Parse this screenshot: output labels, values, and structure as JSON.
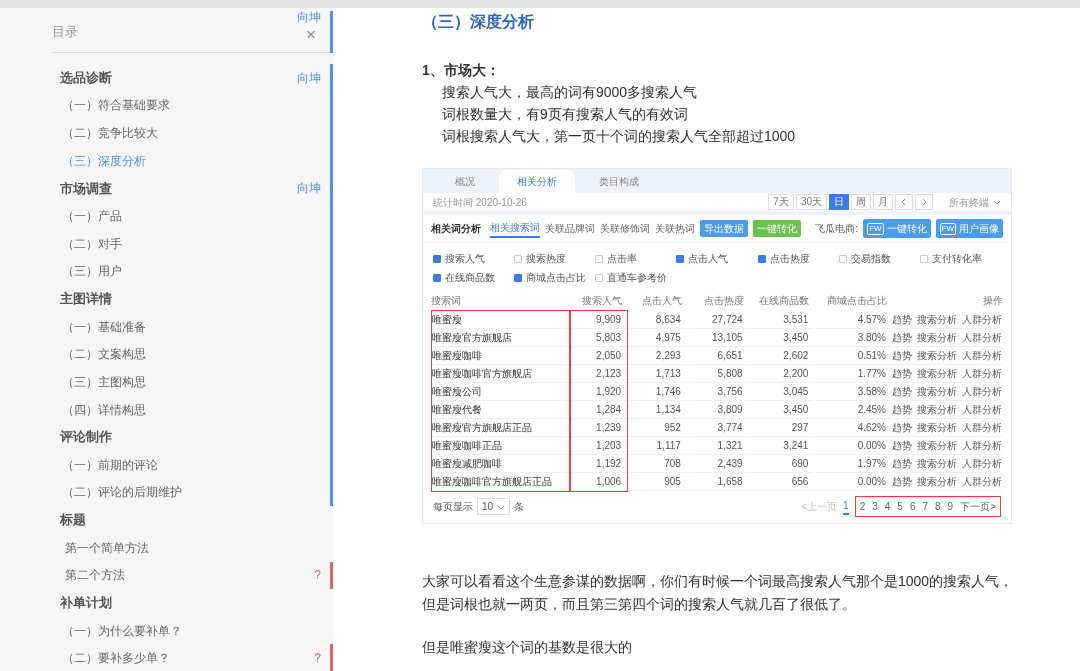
{
  "toc": {
    "title": "目录",
    "close": "×",
    "note": "向坤",
    "color": "#4e8ef7"
  },
  "toc_items": [
    {
      "kind": "heading",
      "label": "选品诊断",
      "selected": false,
      "note": "向坤",
      "color": "#4e8ef7"
    },
    {
      "kind": "sub",
      "label": "（一）符合基础要求",
      "selected": false,
      "color": "#4e8ef7"
    },
    {
      "kind": "sub",
      "label": "（二）竞争比较大",
      "selected": false,
      "color": "#4e8ef7"
    },
    {
      "kind": "sub",
      "label": "（三）深度分析",
      "selected": true,
      "color": "#4e8ef7"
    },
    {
      "kind": "heading",
      "label": "市场调查",
      "selected": false,
      "note": "向坤",
      "color": "#4e8ef7"
    },
    {
      "kind": "sub",
      "label": "（一）产品",
      "selected": false,
      "color": "#4e8ef7"
    },
    {
      "kind": "sub",
      "label": "（二）对手",
      "selected": false,
      "color": "#4e8ef7"
    },
    {
      "kind": "sub",
      "label": "（三）用户",
      "selected": false,
      "color": "#4e8ef7"
    },
    {
      "kind": "heading",
      "label": "主图详情",
      "selected": false,
      "color": "#4e8ef7"
    },
    {
      "kind": "sub",
      "label": "（一）基础准备",
      "selected": false,
      "color": "#4e8ef7"
    },
    {
      "kind": "sub",
      "label": "（二）文案构思",
      "selected": false,
      "color": "#4e8ef7"
    },
    {
      "kind": "sub",
      "label": "（三）主图构思",
      "selected": false,
      "color": "#4e8ef7"
    },
    {
      "kind": "sub",
      "label": "（四）详情构思",
      "selected": false,
      "color": "#4e8ef7"
    },
    {
      "kind": "heading",
      "label": "评论制作",
      "selected": false,
      "color": "#4e8ef7"
    },
    {
      "kind": "sub",
      "label": "（一）前期的评论",
      "selected": false,
      "color": "#4e8ef7"
    },
    {
      "kind": "sub",
      "label": "（二）评论的后期维护",
      "selected": false,
      "color": "#4e8ef7"
    },
    {
      "kind": "heading",
      "label": "标题",
      "selected": false
    },
    {
      "kind": "plain",
      "label": "第一个简单方法",
      "selected": false
    },
    {
      "kind": "plain",
      "label": "第二个方法",
      "selected": false,
      "note": "?",
      "color": "#e8616b"
    },
    {
      "kind": "heading",
      "label": "补单计划",
      "selected": false
    },
    {
      "kind": "sub",
      "label": "（一）为什么要补单？",
      "selected": false
    },
    {
      "kind": "sub",
      "label": "（二）要补多少单？",
      "selected": false,
      "note": "?",
      "color": "#e8616b"
    }
  ],
  "article": {
    "heading": "（三）深度分析",
    "point": "1、市场大：",
    "lines": [
      "搜索人气大，最高的词有9000多搜索人气",
      "词根数量大，有9页有搜索人气的有效词",
      "词根搜索人气大，第一页十个词的搜索人气全部超过1000"
    ],
    "paragraphs": [
      "大家可以看看这个生意参谋的数据啊，你们有时候一个词最高搜索人气那个是1000的搜索人气，但是词根也就一两页，而且第三第四个词的搜索人气就几百了很低了。",
      "但是唯蜜瘦这个词的基数是很大的"
    ]
  },
  "screenshot": {
    "tabs": [
      {
        "label": "概况",
        "selected": false
      },
      {
        "label": "相关分析",
        "selected": true
      },
      {
        "label": "类目构成",
        "selected": false
      }
    ],
    "date": "统计时间 2020-10-26",
    "ranges": [
      {
        "label": "7天",
        "selected": false
      },
      {
        "label": "30天",
        "selected": false
      },
      {
        "label": "日",
        "selected": true
      },
      {
        "label": "周",
        "selected": false
      },
      {
        "label": "月",
        "selected": false
      }
    ],
    "terminal": "所有终端",
    "title": "相关词分析",
    "subtabs": [
      {
        "label": "相关搜索词",
        "selected": true
      },
      {
        "label": "关联品牌词",
        "selected": false
      },
      {
        "label": "关联修饰词",
        "selected": false
      },
      {
        "label": "关联热词",
        "selected": false
      }
    ],
    "actions": [
      {
        "label": "导出数据",
        "kind": "primary"
      },
      {
        "label": "一键转化",
        "kind": "success"
      }
    ],
    "plugin_label": "飞瓜电商:",
    "plugin_buttons": [
      {
        "badge": "FW",
        "label": "一键转化"
      },
      {
        "badge": "FW",
        "label": "用户画像"
      }
    ],
    "metrics": [
      {
        "label": "搜索人气",
        "checked": true
      },
      {
        "label": "搜索热度",
        "checked": false
      },
      {
        "label": "点击率",
        "checked": false
      },
      {
        "label": "点击人气",
        "checked": true
      },
      {
        "label": "点击热度",
        "checked": true
      },
      {
        "label": "交易指数",
        "checked": false
      },
      {
        "label": "支付转化率",
        "checked": false
      },
      {
        "label": "在线商品数",
        "checked": true
      },
      {
        "label": "商城点击占比",
        "checked": true
      },
      {
        "label": "直通车参考价",
        "checked": false
      }
    ],
    "columns": [
      {
        "label": "搜索词",
        "highlighted": true
      },
      {
        "label": "搜索人气",
        "highlighted": true
      },
      {
        "label": "点击人气",
        "highlighted": false
      },
      {
        "label": "点击热度",
        "highlighted": false
      },
      {
        "label": "在线商品数",
        "highlighted": false
      },
      {
        "label": "商城点击占比",
        "highlighted": false
      },
      {
        "label": "操作",
        "highlighted": false
      }
    ],
    "rows": [
      {
        "cells": [
          "唯蜜瘦",
          "9,909",
          "8,634",
          "27,724",
          "3,531",
          "4.57%"
        ],
        "actions": [
          "趋势",
          "搜索分析",
          "人群分析"
        ]
      },
      {
        "cells": [
          "唯蜜瘦官方旗舰店",
          "5,803",
          "4,975",
          "13,105",
          "3,450",
          "3.80%"
        ],
        "actions": [
          "趋势",
          "搜索分析",
          "人群分析"
        ]
      },
      {
        "cells": [
          "唯蜜瘦咖啡",
          "2,050",
          "2,293",
          "6,651",
          "2,602",
          "0.51%"
        ],
        "actions": [
          "趋势",
          "搜索分析",
          "人群分析"
        ]
      },
      {
        "cells": [
          "唯蜜瘦咖啡官方旗舰店",
          "2,123",
          "1,713",
          "5,808",
          "2,200",
          "1.77%"
        ],
        "actions": [
          "趋势",
          "搜索分析",
          "人群分析"
        ]
      },
      {
        "cells": [
          "唯蜜瘦公司",
          "1,920",
          "1,746",
          "3,756",
          "3,045",
          "3.58%"
        ],
        "actions": [
          "趋势",
          "搜索分析",
          "人群分析"
        ]
      },
      {
        "cells": [
          "唯蜜瘦代餐",
          "1,284",
          "1,134",
          "3,809",
          "3,450",
          "2.45%"
        ],
        "actions": [
          "趋势",
          "搜索分析",
          "人群分析"
        ]
      },
      {
        "cells": [
          "唯蜜瘦官方旗舰店正品",
          "1,239",
          "952",
          "3,774",
          "297",
          "4.62%"
        ],
        "actions": [
          "趋势",
          "搜索分析",
          "人群分析"
        ]
      },
      {
        "cells": [
          "唯蜜瘦咖啡正品",
          "1,203",
          "1,117",
          "1,321",
          "3,241",
          "0.00%"
        ],
        "actions": [
          "趋势",
          "搜索分析",
          "人群分析"
        ]
      },
      {
        "cells": [
          "唯蜜瘦减肥咖啡",
          "1,192",
          "708",
          "2,439",
          "690",
          "1.97%"
        ],
        "actions": [
          "趋势",
          "搜索分析",
          "人群分析"
        ]
      },
      {
        "cells": [
          "唯蜜瘦咖啡官方旗舰店正品",
          "1,006",
          "905",
          "1,658",
          "656",
          "0.00%"
        ],
        "actions": [
          "趋势",
          "搜索分析",
          "人群分析"
        ]
      }
    ],
    "page_size": {
      "before": "每页显示",
      "value": "10",
      "after": "条"
    },
    "pagination": {
      "prev": "<上一页",
      "pages": [
        {
          "label": "1",
          "selected": true
        },
        {
          "label": "2",
          "selected": false
        },
        {
          "label": "3",
          "selected": false
        },
        {
          "label": "4",
          "selected": false
        },
        {
          "label": "5",
          "selected": false
        },
        {
          "label": "6",
          "selected": false
        },
        {
          "label": "7",
          "selected": false
        },
        {
          "label": "8",
          "selected": false
        },
        {
          "label": "9",
          "selected": false
        }
      ],
      "next": "下一页>",
      "framed": true
    }
  }
}
